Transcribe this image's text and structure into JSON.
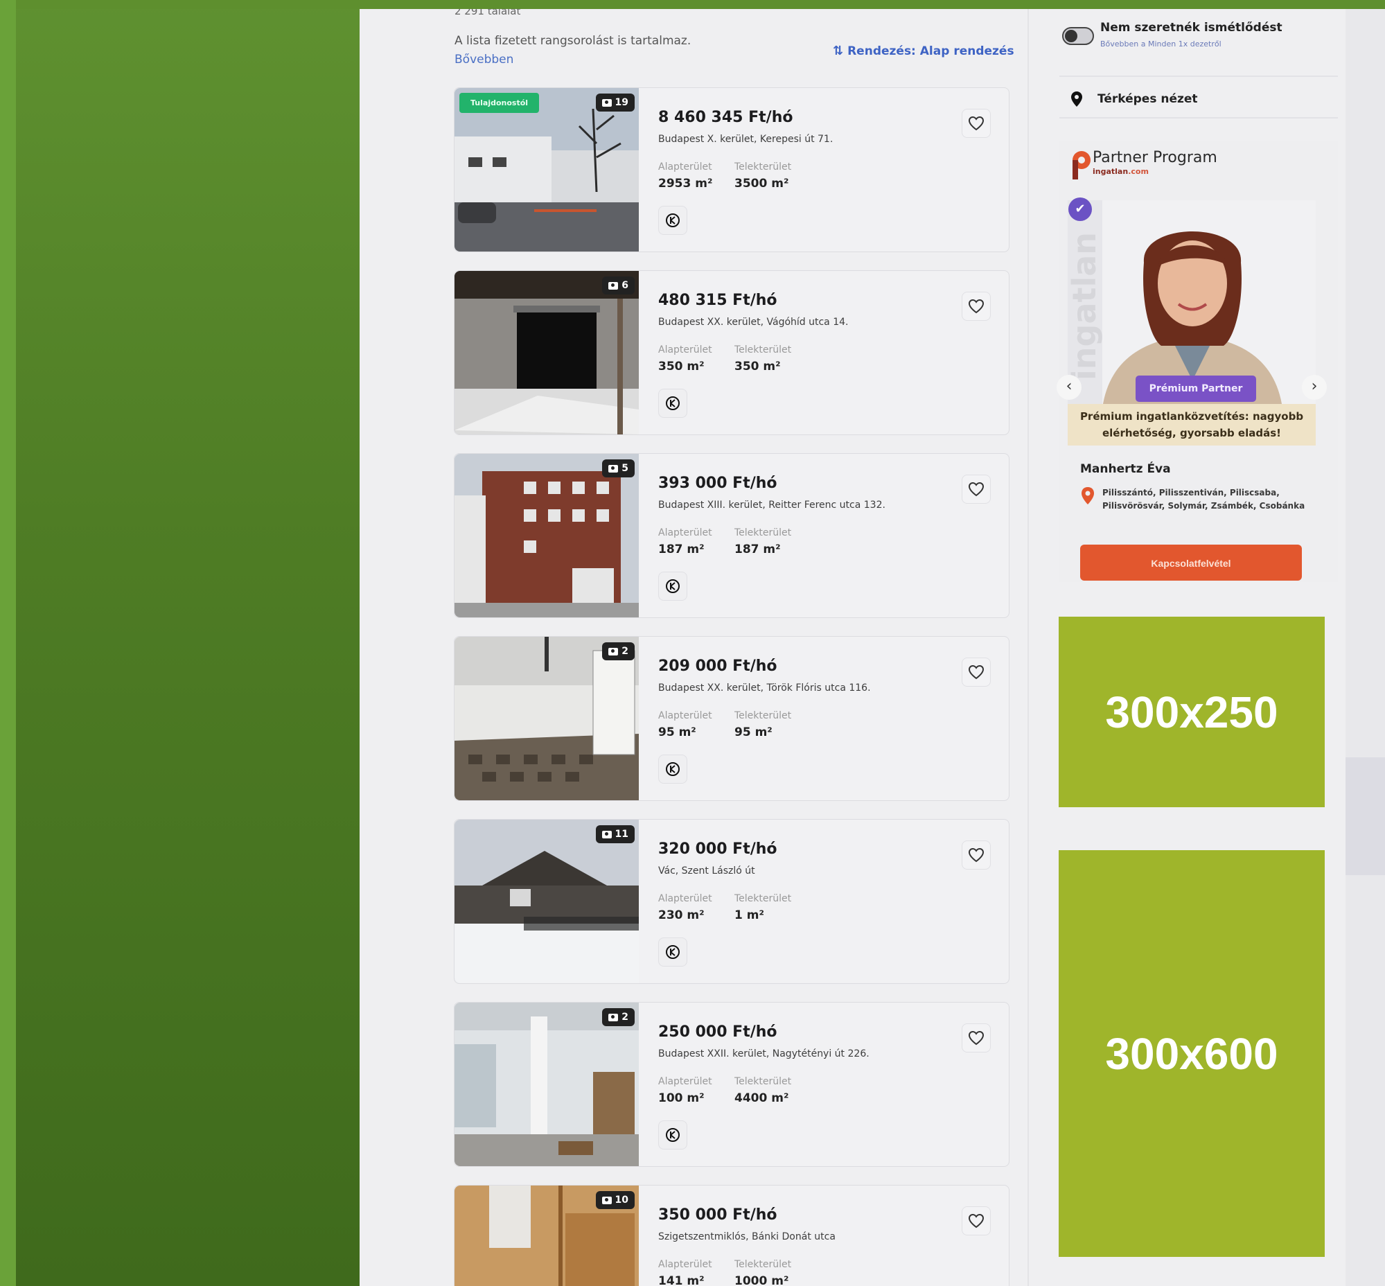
{
  "results": {
    "count": "2 291 találat",
    "paid_note": "A lista fizetett rangsorolást is tartalmaz.",
    "more_link": "Bővebben",
    "sort_label": "Rendezés: Alap rendezés"
  },
  "listings": [
    {
      "price": "8 460 345 Ft/hó",
      "address": "Budapest X. kerület, Kerepesi út 71.",
      "area_label": "Alapterület",
      "area": "2953 m²",
      "lot_label": "Telekterület",
      "lot": "3500 m²",
      "photos": "19",
      "owner_tag": "Tulajdonostól",
      "scene": "warehouse-exterior"
    },
    {
      "price": "480 315 Ft/hó",
      "address": "Budapest XX. kerület, Vágóhíd utca 14.",
      "area_label": "Alapterület",
      "area": "350 m²",
      "lot_label": "Telekterület",
      "lot": "350 m²",
      "photos": "6",
      "owner_tag": "",
      "scene": "garage-door"
    },
    {
      "price": "393 000 Ft/hó",
      "address": "Budapest XIII. kerület, Reitter Ferenc utca 132.",
      "area_label": "Alapterület",
      "area": "187 m²",
      "lot_label": "Telekterület",
      "lot": "187 m²",
      "photos": "5",
      "owner_tag": "",
      "scene": "brick-building"
    },
    {
      "price": "209 000 Ft/hó",
      "address": "Budapest XX. kerület, Török Flóris utca 116.",
      "area_label": "Alapterület",
      "area": "95 m²",
      "lot_label": "Telekterület",
      "lot": "95 m²",
      "photos": "2",
      "owner_tag": "",
      "scene": "empty-hall"
    },
    {
      "price": "320 000 Ft/hó",
      "address": "Vác, Szent László út",
      "area_label": "Alapterület",
      "area": "230 m²",
      "lot_label": "Telekterület",
      "lot": "1 m²",
      "photos": "11",
      "owner_tag": "",
      "scene": "snowy-house"
    },
    {
      "price": "250 000 Ft/hó",
      "address": "Budapest XXII. kerület, Nagytétényi út 226.",
      "area_label": "Alapterület",
      "area": "100 m²",
      "lot_label": "Telekterület",
      "lot": "4400 m²",
      "photos": "2",
      "owner_tag": "",
      "scene": "workshop"
    },
    {
      "price": "350 000 Ft/hó",
      "address": "Szigetszentmiklós, Bánki Donát utca",
      "area_label": "Alapterület",
      "area": "141 m²",
      "lot_label": "Telekterület",
      "lot": "1000 m²",
      "photos": "10",
      "owner_tag": "",
      "scene": "wood-room"
    }
  ],
  "sidebar": {
    "no_repeat_title": "Nem szeretnék ismétlődést",
    "no_repeat_sub": "Bővebben a Minden 1x dezetről",
    "map_view": "Térképes nézet",
    "partner_title": "Partner Program",
    "partner_sub_a": "ingatlan",
    "partner_sub_b": ".com",
    "premium_badge": "Prémium Partner",
    "promo_text": "Prémium ingatlanközvetítés: nagyobb elérhetőség, gyorsabb eladás!",
    "agent_name": "Manhertz Éva",
    "agent_locations": "Pilisszántó, Pilisszentiván, Piliscsaba, Pilisvörösvár, Solymár, Zsámbék, Csobánka",
    "contact_button": "Kapcsolatfelvétel",
    "ad1": "300x250",
    "ad2": "300x600"
  },
  "colors": {
    "accent_blue": "#3e63c4",
    "ad_green": "#9fb52b",
    "contact_orange": "#e2572e",
    "owner_green": "#22b36b",
    "premium_purple": "#7a52c6"
  }
}
